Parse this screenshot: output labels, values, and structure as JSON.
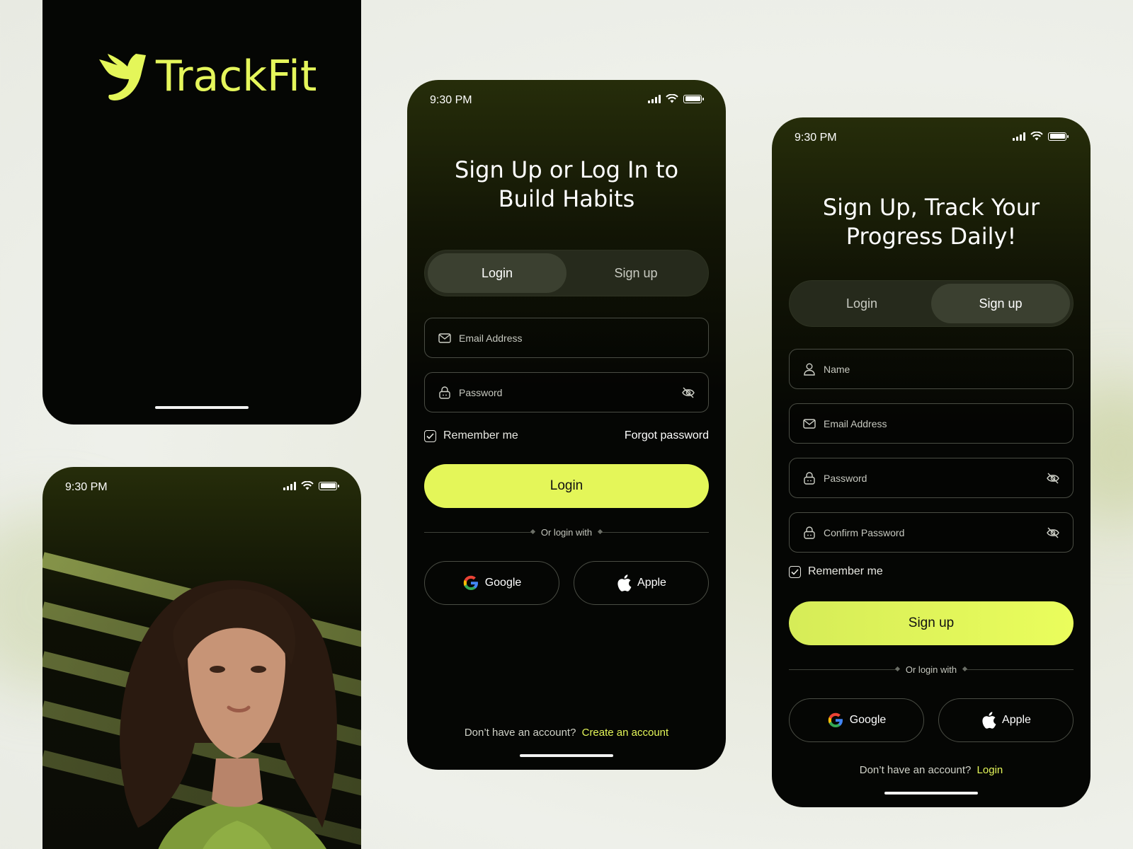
{
  "brand": {
    "name": "TrackFit",
    "accent": "#E4F659"
  },
  "status": {
    "time": "9:30 PM"
  },
  "login_screen": {
    "headline_line1": "Sign Up or Log In to",
    "headline_line2": "Build Habits",
    "tabs": [
      {
        "label": "Login",
        "active": true
      },
      {
        "label": "Sign up",
        "active": false
      }
    ],
    "email_placeholder": "Email Address",
    "password_placeholder": "Password",
    "remember_label": "Remember me",
    "forgot_label": "Forgot password",
    "cta_label": "Login",
    "divider_text": "Or login with",
    "google_label": "Google",
    "apple_label": "Apple",
    "footer_text": "Don’t have an account?",
    "footer_link": "Create an account"
  },
  "signup_screen": {
    "headline_line1": "Sign Up, Track Your",
    "headline_line2": "Progress Daily!",
    "tabs": [
      {
        "label": "Login",
        "active": false
      },
      {
        "label": "Sign up",
        "active": true
      }
    ],
    "name_placeholder": "Name",
    "email_placeholder": "Email Address",
    "password_placeholder": "Password",
    "confirm_placeholder": "Confirm Password",
    "remember_label": "Remember me",
    "cta_label": "Sign up",
    "divider_text": "Or login with",
    "google_label": "Google",
    "apple_label": "Apple",
    "footer_text": "Don’t have an account?",
    "footer_link": "Login"
  },
  "icons": [
    "logo-bird-icon",
    "signal-icon",
    "wifi-icon",
    "battery-icon",
    "mail-icon",
    "lock-icon",
    "eye-off-icon",
    "user-icon",
    "checkbox-checked-icon",
    "google-icon",
    "apple-icon"
  ]
}
